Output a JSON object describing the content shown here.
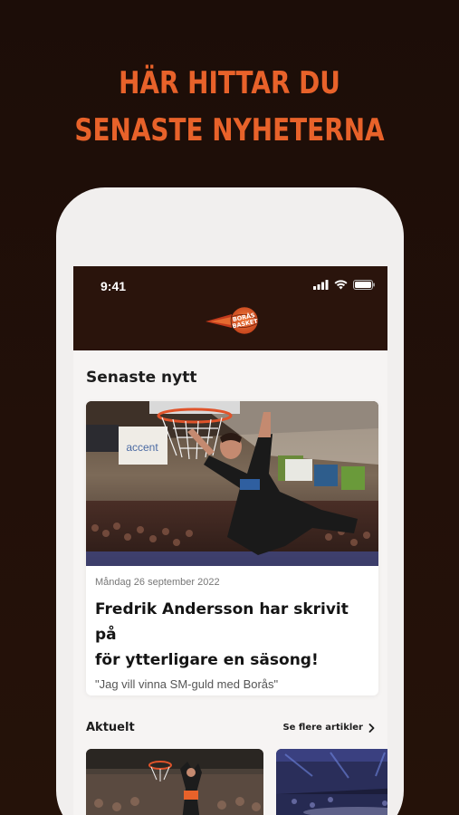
{
  "promo": {
    "headline_line1": "HÄR HITTAR DU",
    "headline_line2": "SENASTE NYHETERNA"
  },
  "status_bar": {
    "time": "9:41"
  },
  "app_bar": {
    "logo_text_1": "BORÅS",
    "logo_text_2": "BASKET"
  },
  "latest": {
    "section_title": "Senaste nytt",
    "article": {
      "date": "Måndag 26 september 2022",
      "title_line1": "Fredrik Andersson har skrivit på",
      "title_line2": "för ytterligare en säsong!",
      "subtitle": "\"Jag vill vinna SM-guld med Borås\""
    }
  },
  "current": {
    "section_title": "Aktuelt",
    "see_more": "Se flere artikler"
  },
  "colors": {
    "accent": "#e8622a",
    "background": "#1c0d08",
    "app_bar": "#2a140c"
  }
}
